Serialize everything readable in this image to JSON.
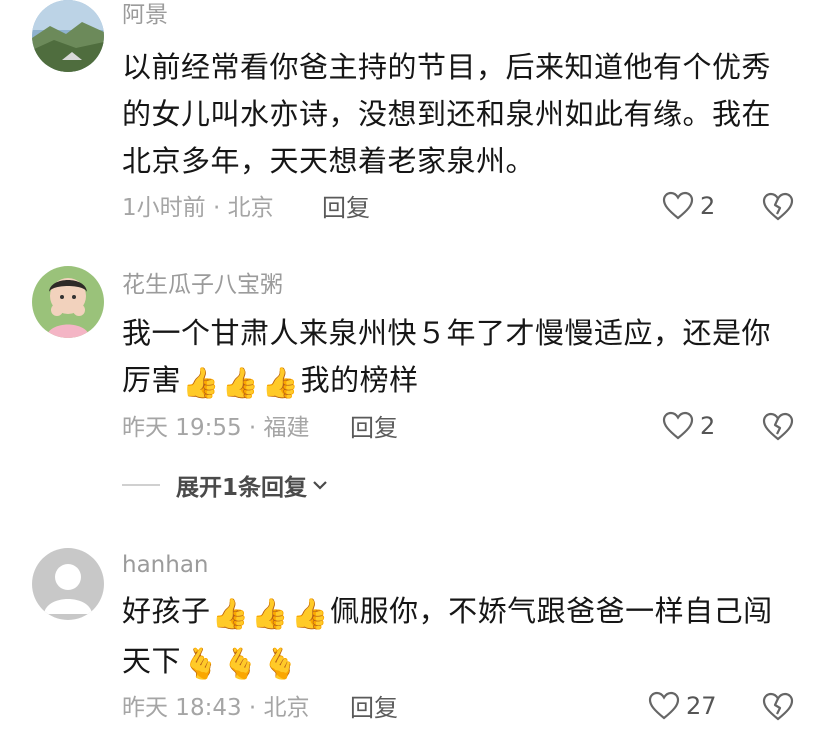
{
  "comments": [
    {
      "username": "阿景",
      "lines": [
        "以前经常看你爸主持的节目，后来知道他有个优秀",
        "的女儿叫水亦诗，没想到还和泉州如此有缘。我在",
        "北京多年，天天想着老家泉州。"
      ],
      "meta": "1小时前 · 北京",
      "reply": "回复",
      "likes": "2",
      "avatar": "landscape-photo"
    },
    {
      "username": "花生瓜子八宝粥",
      "line1": "我一个甘肃人来泉州快５年了才慢慢适应，还是你",
      "line2_a": "厉害",
      "line2_b": "我的榜样",
      "emoji": "👍",
      "meta": "昨天 19:55 · 福建",
      "reply": "回复",
      "likes": "2",
      "expand": "展开1条回复",
      "avatar": "child-photo"
    },
    {
      "username": "hanhan",
      "line1_a": "好孩子",
      "line1_b": "佩服你，不娇气跟爸爸一样自己闯",
      "line2_a": "天下",
      "emoji_thumb": "👍",
      "emoji_heart": "🫰",
      "meta": "昨天 18:43 · 北京",
      "reply": "回复",
      "likes": "27",
      "avatar": "default-user"
    }
  ],
  "colors": {
    "text": "#161616",
    "secondary": "#9b9b9b"
  }
}
